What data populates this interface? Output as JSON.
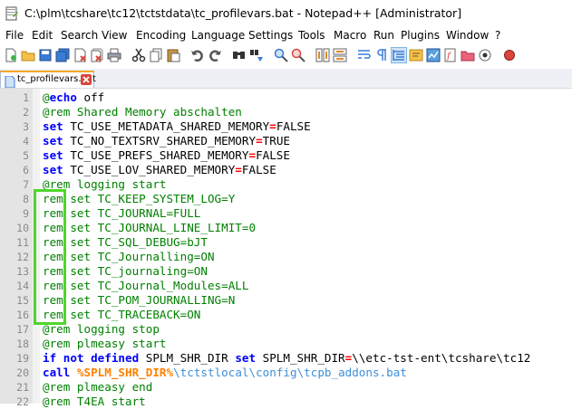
{
  "window": {
    "title": "C:\\plm\\tcshare\\tc12\\tctstdata\\tc_profilevars.bat - Notepad++ [Administrator]"
  },
  "menu": {
    "items": [
      "File",
      "Edit",
      "Search",
      "View",
      "Encoding",
      "Language",
      "Settings",
      "Tools",
      "Macro",
      "Run",
      "Plugins",
      "Window",
      "?"
    ]
  },
  "toolbar": {
    "icons": [
      "new-file-icon",
      "open-file-icon",
      "save-icon",
      "save-all-icon",
      "close-icon",
      "close-all-icon",
      "print-icon",
      "cut-icon",
      "copy-icon",
      "paste-icon",
      "undo-icon",
      "redo-icon",
      "find-icon",
      "replace-icon",
      "zoom-in-icon",
      "zoom-out-icon",
      "sync-vertical-icon",
      "sync-horizontal-icon",
      "word-wrap-icon",
      "show-all-chars-icon",
      "indent-guide-icon",
      "user-language-icon",
      "doc-map-icon",
      "function-list-icon",
      "folder-workspace-icon",
      "monitoring-icon",
      "record-macro-icon"
    ]
  },
  "tab": {
    "label": "tc_profilevars.bat",
    "active": true
  },
  "editor": {
    "lines": [
      {
        "n": "1",
        "tokens": [
          {
            "c": "cmt",
            "t": "@"
          },
          {
            "c": "kw",
            "t": "echo"
          },
          {
            "c": "plain",
            "t": " off"
          }
        ]
      },
      {
        "n": "2",
        "tokens": [
          {
            "c": "cmt",
            "t": "@rem Shared Memory abschalten"
          }
        ]
      },
      {
        "n": "3",
        "tokens": [
          {
            "c": "kw",
            "t": "set"
          },
          {
            "c": "plain",
            "t": " TC_USE_METADATA_SHARED_MEMORY"
          },
          {
            "c": "op",
            "t": "="
          },
          {
            "c": "plain",
            "t": "FALSE"
          }
        ]
      },
      {
        "n": "4",
        "tokens": [
          {
            "c": "kw",
            "t": "set"
          },
          {
            "c": "plain",
            "t": " TC_NO_TEXTSRV_SHARED_MEMORY"
          },
          {
            "c": "op",
            "t": "="
          },
          {
            "c": "plain",
            "t": "TRUE"
          }
        ]
      },
      {
        "n": "5",
        "tokens": [
          {
            "c": "kw",
            "t": "set"
          },
          {
            "c": "plain",
            "t": " TC_USE_PREFS_SHARED_MEMORY"
          },
          {
            "c": "op",
            "t": "="
          },
          {
            "c": "plain",
            "t": "FALSE"
          }
        ]
      },
      {
        "n": "6",
        "tokens": [
          {
            "c": "kw",
            "t": "set"
          },
          {
            "c": "plain",
            "t": " TC_USE_LOV_SHARED_MEMORY"
          },
          {
            "c": "op",
            "t": "="
          },
          {
            "c": "plain",
            "t": "FALSE"
          }
        ]
      },
      {
        "n": "7",
        "tokens": [
          {
            "c": "cmt",
            "t": "@rem logging start"
          }
        ]
      },
      {
        "n": "8",
        "tokens": [
          {
            "c": "cmt",
            "t": "rem set TC_KEEP_SYSTEM_LOG=Y"
          }
        ]
      },
      {
        "n": "9",
        "tokens": [
          {
            "c": "cmt",
            "t": "rem set TC_JOURNAL=FULL"
          }
        ]
      },
      {
        "n": "10",
        "tokens": [
          {
            "c": "cmt",
            "t": "rem set TC_JOURNAL_LINE_LIMIT=0"
          }
        ]
      },
      {
        "n": "11",
        "tokens": [
          {
            "c": "cmt",
            "t": "rem set TC_SQL_DEBUG=bJT"
          }
        ]
      },
      {
        "n": "12",
        "tokens": [
          {
            "c": "cmt",
            "t": "rem set TC_Journalling=ON"
          }
        ]
      },
      {
        "n": "13",
        "tokens": [
          {
            "c": "cmt",
            "t": "rem set TC_journaling=ON"
          }
        ]
      },
      {
        "n": "14",
        "tokens": [
          {
            "c": "cmt",
            "t": "rem set TC_Journal_Modules=ALL"
          }
        ]
      },
      {
        "n": "15",
        "tokens": [
          {
            "c": "cmt",
            "t": "rem set TC_POM_JOURNALLING=N"
          }
        ]
      },
      {
        "n": "16",
        "tokens": [
          {
            "c": "cmt",
            "t": "rem set TC_TRACEBACK=ON"
          }
        ]
      },
      {
        "n": "17",
        "tokens": [
          {
            "c": "cmt",
            "t": "@rem logging stop"
          }
        ]
      },
      {
        "n": "18",
        "tokens": [
          {
            "c": "cmt",
            "t": "@rem plmeasy start"
          }
        ]
      },
      {
        "n": "19",
        "tokens": [
          {
            "c": "kw",
            "t": "if not defined"
          },
          {
            "c": "plain",
            "t": " SPLM_SHR_DIR "
          },
          {
            "c": "kw",
            "t": "set"
          },
          {
            "c": "plain",
            "t": " SPLM_SHR_DIR"
          },
          {
            "c": "op",
            "t": "="
          },
          {
            "c": "plain",
            "t": "\\\\etc-tst-ent\\tcshare\\tc12"
          }
        ]
      },
      {
        "n": "20",
        "tokens": [
          {
            "c": "kw",
            "t": "call"
          },
          {
            "c": "plain",
            "t": " "
          },
          {
            "c": "var",
            "t": "%SPLM_SHR_DIR%"
          },
          {
            "c": "path",
            "t": "\\tctstlocal\\config\\tcpb_addons.bat"
          }
        ]
      },
      {
        "n": "21",
        "tokens": [
          {
            "c": "cmt",
            "t": "@rem plmeasy end"
          }
        ]
      },
      {
        "n": "22",
        "tokens": [
          {
            "c": "cmt",
            "t": "@rem T4EA start"
          }
        ]
      }
    ]
  },
  "colors": {
    "keyword": "#0000ff",
    "comment": "#008000",
    "operator": "#ff0000",
    "variable": "#ff8000",
    "highlight": "#4fd62a"
  }
}
